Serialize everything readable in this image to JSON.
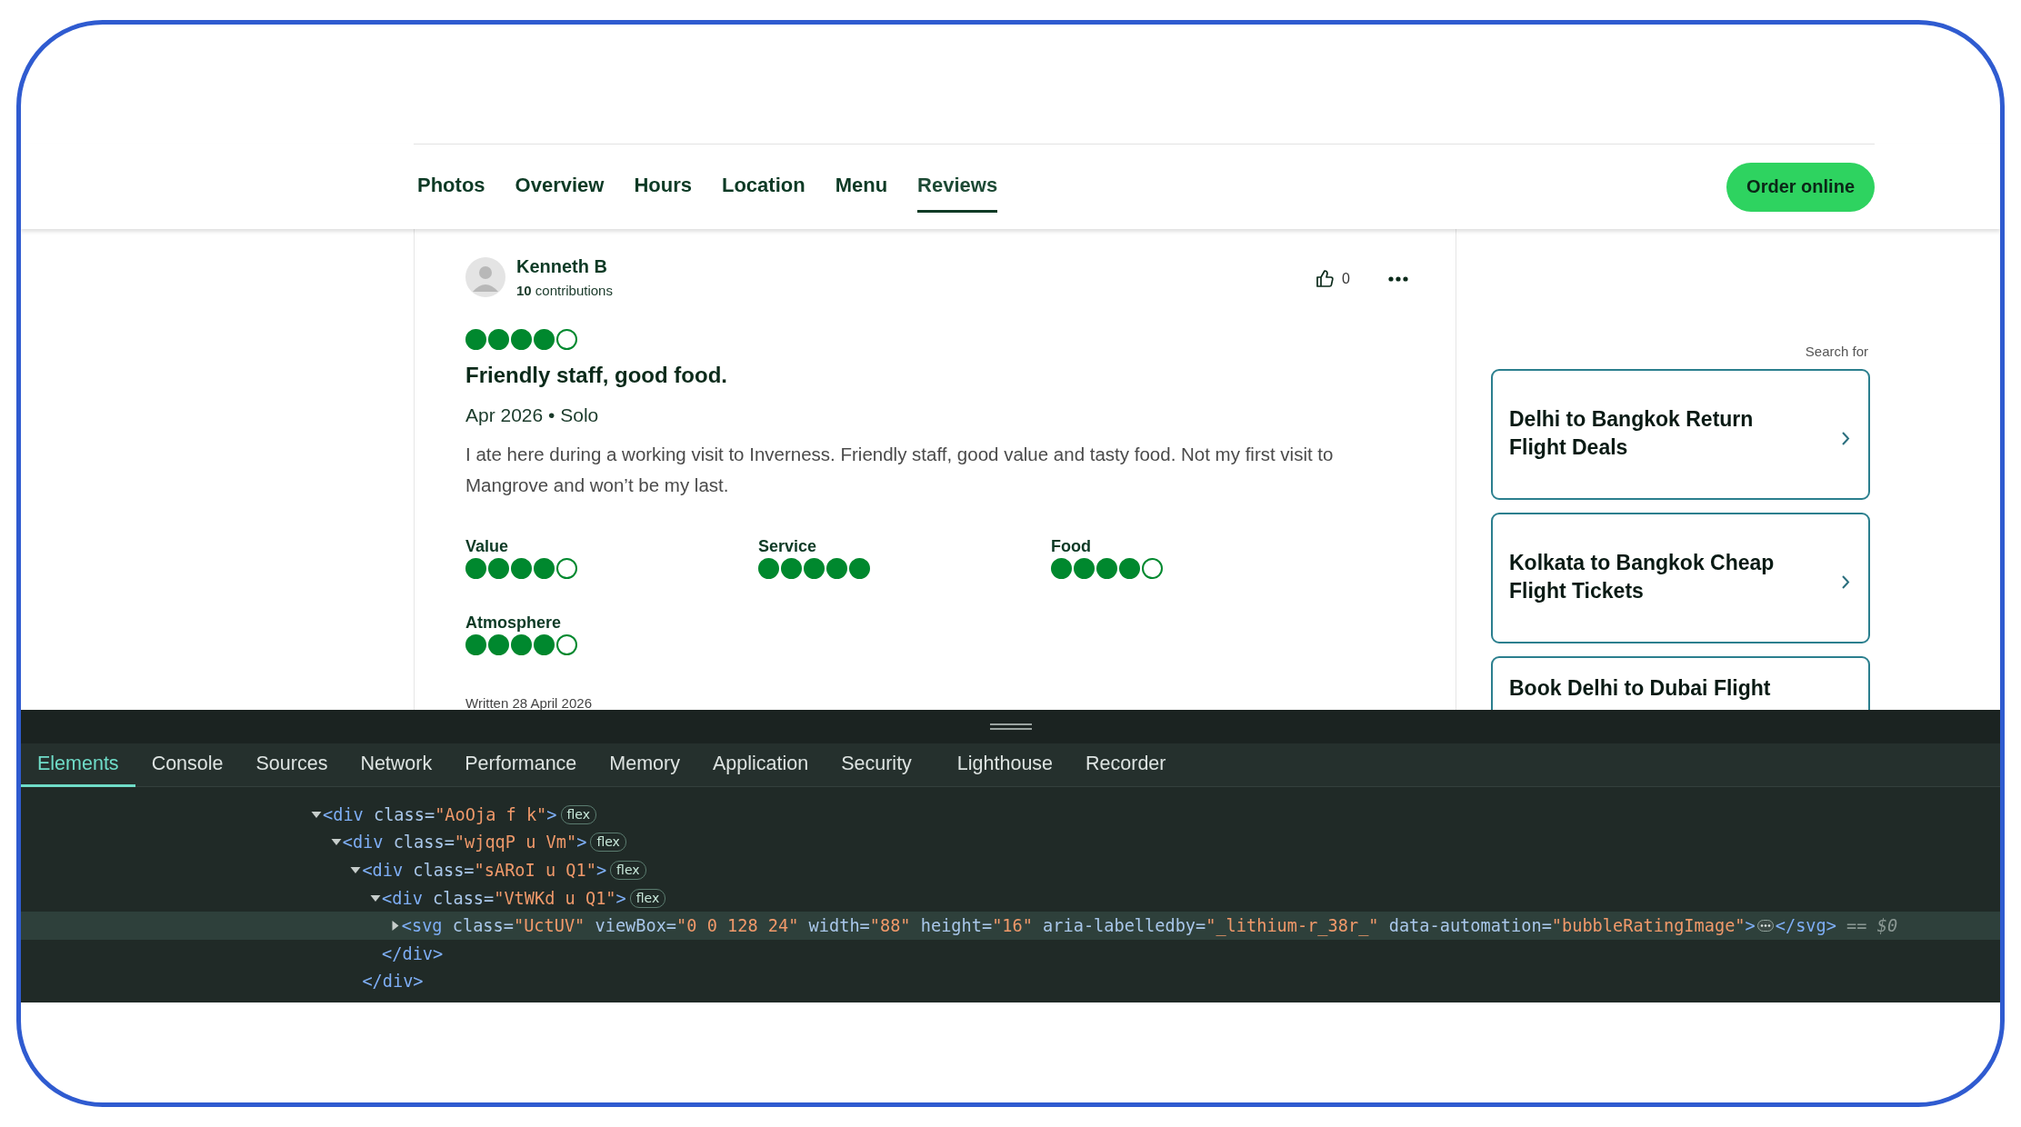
{
  "page": {
    "nav": {
      "tabs": [
        {
          "label": "Photos",
          "selected": false
        },
        {
          "label": "Overview",
          "selected": false
        },
        {
          "label": "Hours",
          "selected": false
        },
        {
          "label": "Location",
          "selected": false
        },
        {
          "label": "Menu",
          "selected": false
        },
        {
          "label": "Reviews",
          "selected": true
        }
      ],
      "order_button": "Order online"
    },
    "review": {
      "author": "Kenneth B",
      "contributions": "**10** contributions",
      "helpful_count": "0",
      "stars": 4,
      "title": "Friendly staff, good food.",
      "meta": "Apr 2026 • Solo",
      "body": "I ate here during a working visit to Inverness. Friendly staff, good value and tasty food. Not my first visit to Mangrove and won’t be my last.",
      "sub_ratings": [
        {
          "label": "Value",
          "stars": 4
        },
        {
          "label": "Service",
          "stars": 5
        },
        {
          "label": "Food",
          "stars": 4
        },
        {
          "label": "Atmosphere",
          "stars": 4
        }
      ],
      "written": "Written 28 April 2026"
    },
    "sidebar": {
      "heading": "Search for",
      "links": [
        "Delhi to Bangkok Return Flight Deals",
        "Kolkata to Bangkok Cheap Flight Tickets",
        "Book Delhi to Dubai Flight"
      ]
    }
  },
  "devtools": {
    "tabs": [
      {
        "label": "Elements",
        "selected": true
      },
      {
        "label": "Console",
        "selected": false
      },
      {
        "label": "Sources",
        "selected": false
      },
      {
        "label": "Network",
        "selected": false
      },
      {
        "label": "Performance",
        "selected": false
      },
      {
        "label": "Memory",
        "selected": false
      },
      {
        "label": "Application",
        "selected": false
      },
      {
        "label": "Security",
        "selected": false
      },
      {
        "label": "Lighthouse",
        "selected": false
      },
      {
        "label": "Recorder",
        "selected": false
      }
    ],
    "dom_tree": [
      {
        "tokens": [
          {
            "kind": "tag",
            "text": "<div"
          },
          {
            "kind": "attr",
            "text": " class="
          },
          {
            "kind": "value",
            "text": "\"AoOja f k\""
          },
          {
            "kind": "tag",
            "text": ">"
          }
        ],
        "badge": "flex",
        "expanded": true,
        "selected": false,
        "children": [
          {
            "tokens": [
              {
                "kind": "tag",
                "text": "<div"
              },
              {
                "kind": "attr",
                "text": " class="
              },
              {
                "kind": "value",
                "text": "\"wjqqP u Vm\""
              },
              {
                "kind": "tag",
                "text": ">"
              }
            ],
            "badge": "flex",
            "expanded": true,
            "selected": false,
            "children": [
              {
                "tokens": [
                  {
                    "kind": "tag",
                    "text": "<div"
                  },
                  {
                    "kind": "attr",
                    "text": " class="
                  },
                  {
                    "kind": "value",
                    "text": "\"sARoI u Q1\""
                  },
                  {
                    "kind": "tag",
                    "text": ">"
                  }
                ],
                "badge": "flex",
                "expanded": true,
                "selected": false,
                "closing": [
                  {
                    "kind": "tag",
                    "text": "</div>"
                  }
                ],
                "children": [
                  {
                    "tokens": [
                      {
                        "kind": "tag",
                        "text": "<div"
                      },
                      {
                        "kind": "attr",
                        "text": " class="
                      },
                      {
                        "kind": "value",
                        "text": "\"VtWKd u Q1\""
                      },
                      {
                        "kind": "tag",
                        "text": ">"
                      }
                    ],
                    "badge": "flex",
                    "expanded": true,
                    "selected": false,
                    "closing": [
                      {
                        "kind": "tag",
                        "text": "</div>"
                      }
                    ],
                    "children": [
                      {
                        "tokens": [
                          {
                            "kind": "tag",
                            "text": "<svg"
                          },
                          {
                            "kind": "attr",
                            "text": " class="
                          },
                          {
                            "kind": "value",
                            "text": "\"UctUV\""
                          },
                          {
                            "kind": "attr",
                            "text": " viewBox="
                          },
                          {
                            "kind": "value",
                            "text": "\"0 0 128 24\""
                          },
                          {
                            "kind": "attr",
                            "text": " width="
                          },
                          {
                            "kind": "value",
                            "text": "\"88\""
                          },
                          {
                            "kind": "attr",
                            "text": " height="
                          },
                          {
                            "kind": "value",
                            "text": "\"16\""
                          },
                          {
                            "kind": "attr",
                            "text": " aria-labelledby="
                          },
                          {
                            "kind": "value",
                            "text": "\"_lithium-r_38r_\""
                          },
                          {
                            "kind": "attr",
                            "text": " data-automation="
                          },
                          {
                            "kind": "value",
                            "text": "\"bubbleRatingImage\""
                          },
                          {
                            "kind": "tag",
                            "text": ">"
                          },
                          {
                            "kind": "ellipsis"
                          },
                          {
                            "kind": "tag",
                            "text": "</svg>"
                          },
                          {
                            "kind": "ref",
                            "text": " == $0"
                          }
                        ],
                        "expanded": false,
                        "selected": true
                      }
                    ]
                  }
                ]
              }
            ]
          }
        ]
      }
    ]
  }
}
